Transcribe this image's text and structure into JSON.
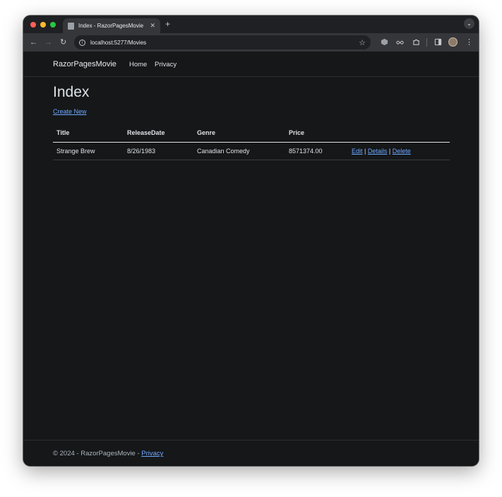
{
  "browser": {
    "tab_title": "Index - RazorPagesMovie",
    "new_tab": "+",
    "url": "localhost:5277/Movies",
    "colors": {
      "close": "#ff5f57",
      "minimize": "#febc2e",
      "maximize": "#28c840"
    }
  },
  "nav": {
    "brand": "RazorPagesMovie",
    "home": "Home",
    "privacy": "Privacy"
  },
  "main": {
    "heading": "Index",
    "create_link": "Create New",
    "table": {
      "headers": [
        "Title",
        "ReleaseDate",
        "Genre",
        "Price"
      ],
      "rows": [
        {
          "title": "Strange Brew",
          "release_date": "8/26/1983",
          "genre": "Canadian Comedy",
          "price": "8571374.00",
          "edit": "Edit",
          "details": "Details",
          "delete": "Delete",
          "sep": "|"
        }
      ]
    }
  },
  "footer": {
    "text": "© 2024 - RazorPagesMovie - ",
    "privacy": "Privacy"
  }
}
